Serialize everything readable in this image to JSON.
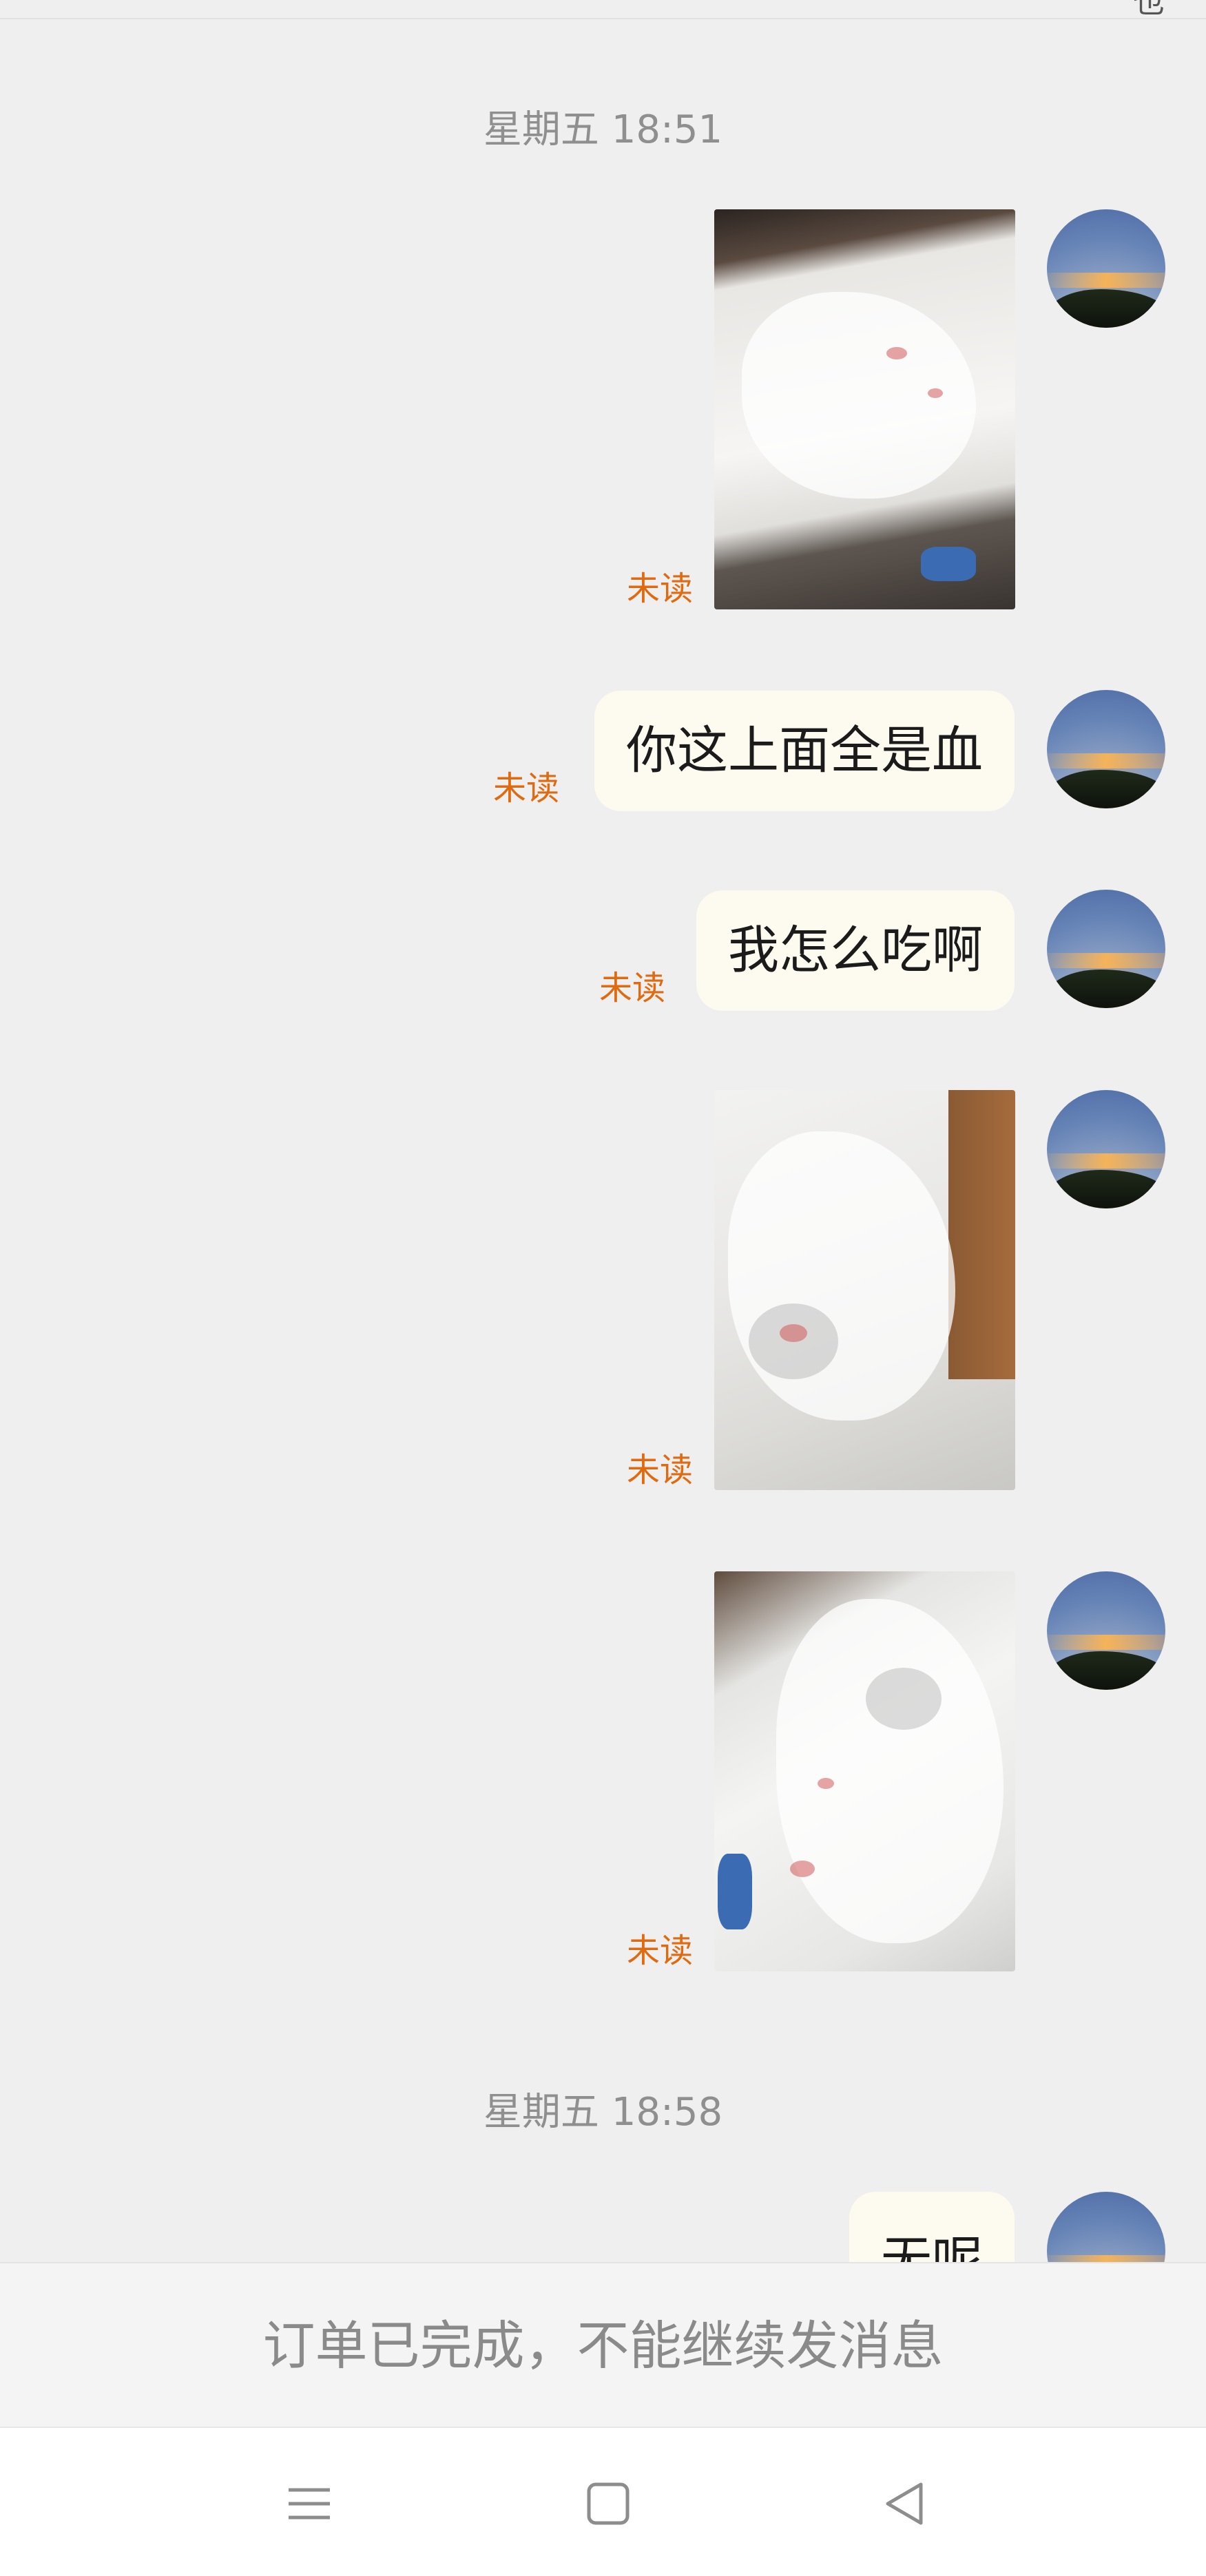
{
  "status_bar": {
    "corner_glyph": "也"
  },
  "chat": {
    "timestamps": [
      "星期五 18:51",
      "星期五 18:58"
    ],
    "unread_label": "未读",
    "messages": [
      {
        "type": "image",
        "description_icon": "photo-bag-blood-1",
        "status": "未读"
      },
      {
        "type": "text",
        "text": "你这上面全是血",
        "status": "未读"
      },
      {
        "type": "text",
        "text": "我怎么吃啊",
        "status": "未读"
      },
      {
        "type": "image",
        "description_icon": "photo-bag-blood-2",
        "status": "未读"
      },
      {
        "type": "image",
        "description_icon": "photo-bag-blood-3",
        "status": "未读"
      },
      {
        "type": "text",
        "text": "无呢",
        "status": ""
      }
    ]
  },
  "footer": {
    "notice": "订单已完成，不能继续发消息"
  },
  "nav": {
    "icons": [
      "menu-icon",
      "home-icon",
      "back-icon"
    ]
  },
  "colors": {
    "background": "#efefef",
    "bubble": "#fdfaef",
    "unread": "#e06a10",
    "timestamp": "#8f8f8f"
  }
}
